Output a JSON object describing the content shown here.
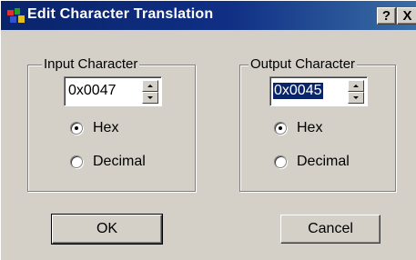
{
  "window": {
    "title": "Edit Character Translation",
    "help_label": "?",
    "close_label": "X",
    "icon": "app-icon"
  },
  "input_group": {
    "label": "Input Character",
    "value": "0x0047",
    "options": [
      {
        "label": "Hex",
        "checked": true
      },
      {
        "label": "Decimal",
        "checked": false
      }
    ]
  },
  "output_group": {
    "label": "Output Character",
    "value": "0x0045",
    "value_selected": true,
    "options": [
      {
        "label": "Hex",
        "checked": true
      },
      {
        "label": "Decimal",
        "checked": false
      }
    ]
  },
  "buttons": {
    "ok_label": "OK",
    "cancel_label": "Cancel"
  },
  "colors": {
    "titlebar_start": "#0a246a",
    "titlebar_end": "#3a6ea5",
    "face": "#d4d0c8",
    "selection": "#0a246a"
  }
}
